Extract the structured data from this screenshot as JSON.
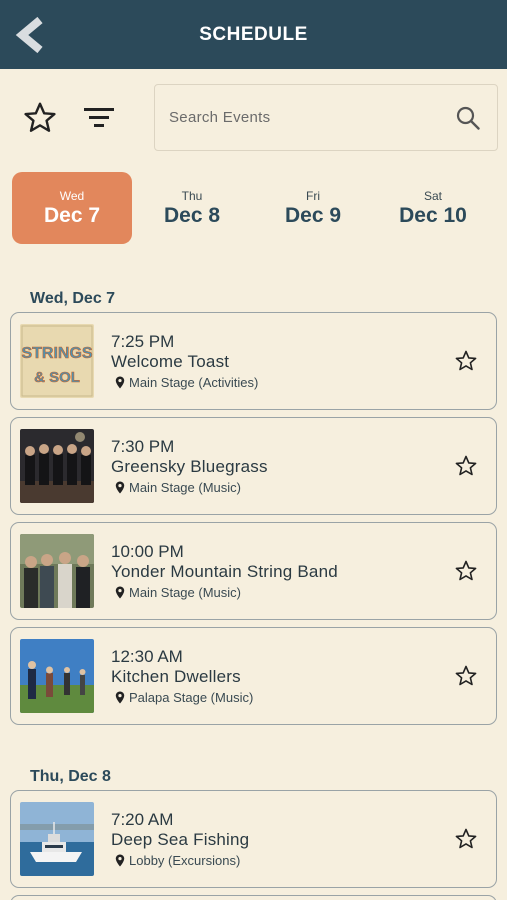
{
  "header": {
    "title": "SCHEDULE"
  },
  "search": {
    "placeholder": "Search Events"
  },
  "days": [
    {
      "dow": "Wed",
      "date": "Dec 7",
      "active": true
    },
    {
      "dow": "Thu",
      "date": "Dec 8",
      "active": false
    },
    {
      "dow": "Fri",
      "date": "Dec 9",
      "active": false
    },
    {
      "dow": "Sat",
      "date": "Dec 10",
      "active": false
    }
  ],
  "sections": [
    {
      "label": "Wed, Dec 7",
      "events": [
        {
          "time": "7:25 PM",
          "title": "Welcome Toast",
          "location": "Main Stage (Activities)"
        },
        {
          "time": "7:30 PM",
          "title": "Greensky Bluegrass",
          "location": "Main Stage (Music)"
        },
        {
          "time": "10:00 PM",
          "title": "Yonder Mountain String Band",
          "location": "Main Stage (Music)"
        },
        {
          "time": "12:30 AM",
          "title": "Kitchen Dwellers",
          "location": "Palapa Stage (Music)"
        }
      ]
    },
    {
      "label": "Thu, Dec 8",
      "events": [
        {
          "time": "7:20 AM",
          "title": "Deep Sea Fishing",
          "location": "Lobby (Excursions)"
        }
      ]
    }
  ],
  "logo": {
    "line1": "STRINGS",
    "line2": "& SOL"
  },
  "colors": {
    "header": "#2c4a5a",
    "accent": "#e2875c",
    "background": "#f6efde"
  }
}
